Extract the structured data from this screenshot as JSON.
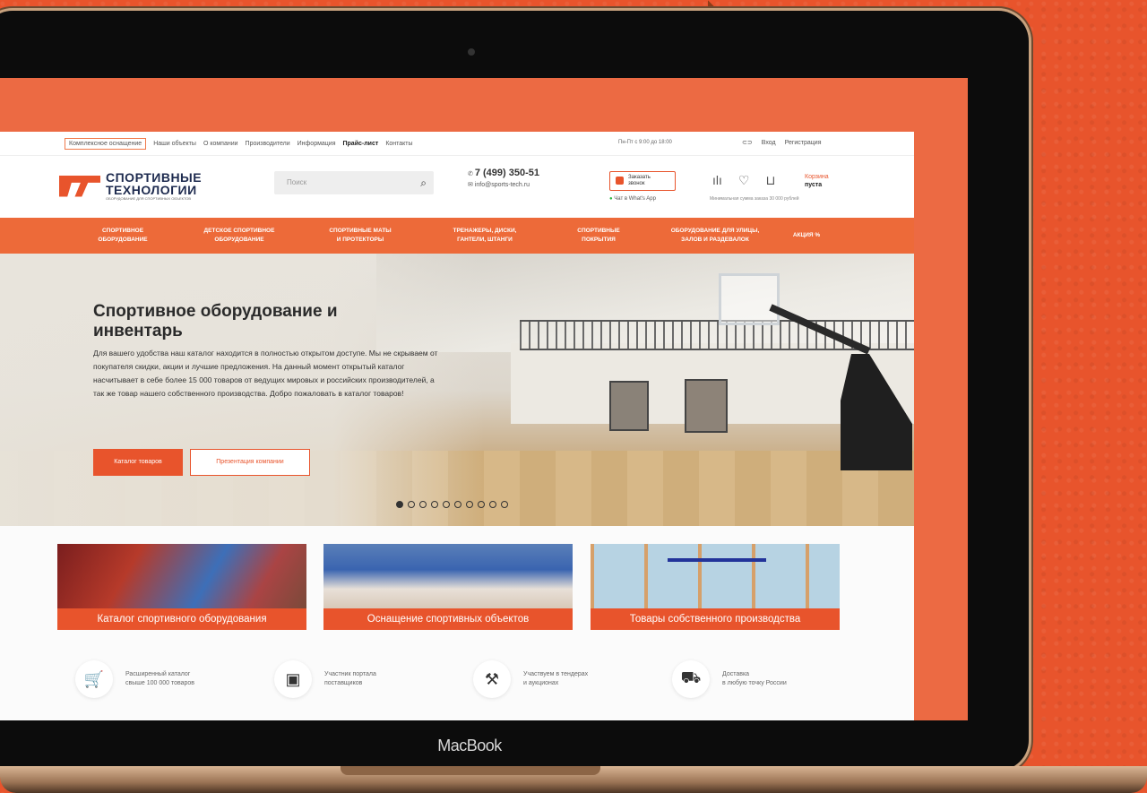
{
  "device": {
    "label": "MacBook"
  },
  "topbar": {
    "nav": [
      "Комплексное оснащение",
      "Наши объекты",
      "О компании",
      "Производители",
      "Информация",
      "Прайс-лист",
      "Контакты"
    ],
    "hours": "Пн-Пт с 9:00 до 18:00",
    "login": "Вход",
    "register": "Регистрация"
  },
  "header": {
    "logo_line1": "СПОРТИВНЫЕ",
    "logo_line2": "ТЕХНОЛОГИИ",
    "logo_sub": "ОБОРУДОВАНИЕ ДЛЯ СПОРТИВНЫХ ОБЪЕКТОВ",
    "search_placeholder": "Поиск",
    "phone": "7 (499) 350-51",
    "email": "info@sports-tech.ru",
    "callback_line1": "Заказать",
    "callback_line2": "звонок",
    "whatsapp": "Чат в What's App",
    "cart_title": "Корзина",
    "cart_value": "пуста",
    "min_sum": "Минимальная сумма заказа 30 000 рублей"
  },
  "menu": [
    {
      "line1": "Спортивное",
      "line2": "оборудование"
    },
    {
      "line1": "Детское спортивное",
      "line2": "оборудование"
    },
    {
      "line1": "Спортивные маты",
      "line2": "и протекторы"
    },
    {
      "line1": "Тренажеры, диски,",
      "line2": "гантели, штанги"
    },
    {
      "line1": "Спортивные",
      "line2": "покрытия"
    },
    {
      "line1": "Оборудование для улицы,",
      "line2": "залов и раздевалок"
    },
    {
      "line1": "Акция %",
      "line2": ""
    }
  ],
  "hero": {
    "title": "Спортивное оборудование и инвентарь",
    "text": "Для вашего удобства наш каталог находится в полностью открытом доступе. Мы не скрываем от покупателя скидки, акции и лучшие предложения. На данный момент открытый каталог насчитывает в себе более 15 000 товаров от ведущих мировых и российских производителей, а так же товар нашего собственного производства. Добро пожаловать в каталог товаров!",
    "btn_catalog": "Каталог товаров",
    "btn_presentation": "Презентация компании",
    "slides_count": 10,
    "active_slide": 1
  },
  "categories": [
    {
      "label": "Каталог спортивного оборудования"
    },
    {
      "label": "Оснащение спортивных объектов"
    },
    {
      "label": "Товары собственного производства"
    }
  ],
  "features": [
    {
      "line1": "Расширенный каталог",
      "line2": "свыше 100 000 товаров",
      "icon": "basket-icon"
    },
    {
      "line1": "Участник портала",
      "line2": "поставщиков",
      "icon": "portal-icon"
    },
    {
      "line1": "Участвуем в тендерах",
      "line2": "и аукционах",
      "icon": "gavel-icon"
    },
    {
      "line1": "Доставка",
      "line2": "в любую точку России",
      "icon": "truck-icon"
    }
  ],
  "colors": {
    "accent": "#e8542c",
    "brand_dark": "#1e2b4f"
  }
}
